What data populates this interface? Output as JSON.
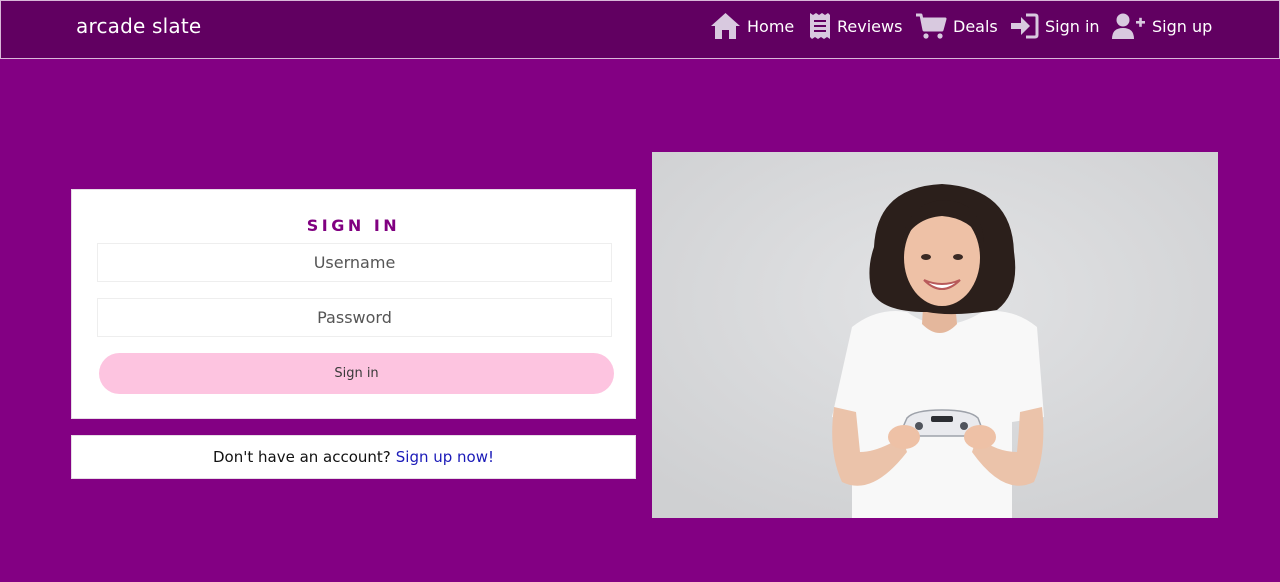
{
  "navbar": {
    "brand": "arcade slate",
    "items": [
      {
        "label": "Home",
        "icon": "home-icon"
      },
      {
        "label": "Reviews",
        "icon": "receipt-icon"
      },
      {
        "label": "Deals",
        "icon": "cart-icon"
      },
      {
        "label": "Sign in",
        "icon": "sign-in-icon"
      },
      {
        "label": "Sign up",
        "icon": "user-plus-icon"
      }
    ]
  },
  "signin": {
    "title": "SIGN IN",
    "username_placeholder": "Username",
    "password_placeholder": "Password",
    "submit_label": "Sign in"
  },
  "signup": {
    "prompt": "Don't have an account?",
    "link_label": "Sign up now!"
  },
  "colors": {
    "page_bg": "#830083",
    "navbar_bg": "#610061",
    "title": "#800080",
    "button_bg": "#fdc4e0",
    "link": "#1a1ab8"
  }
}
